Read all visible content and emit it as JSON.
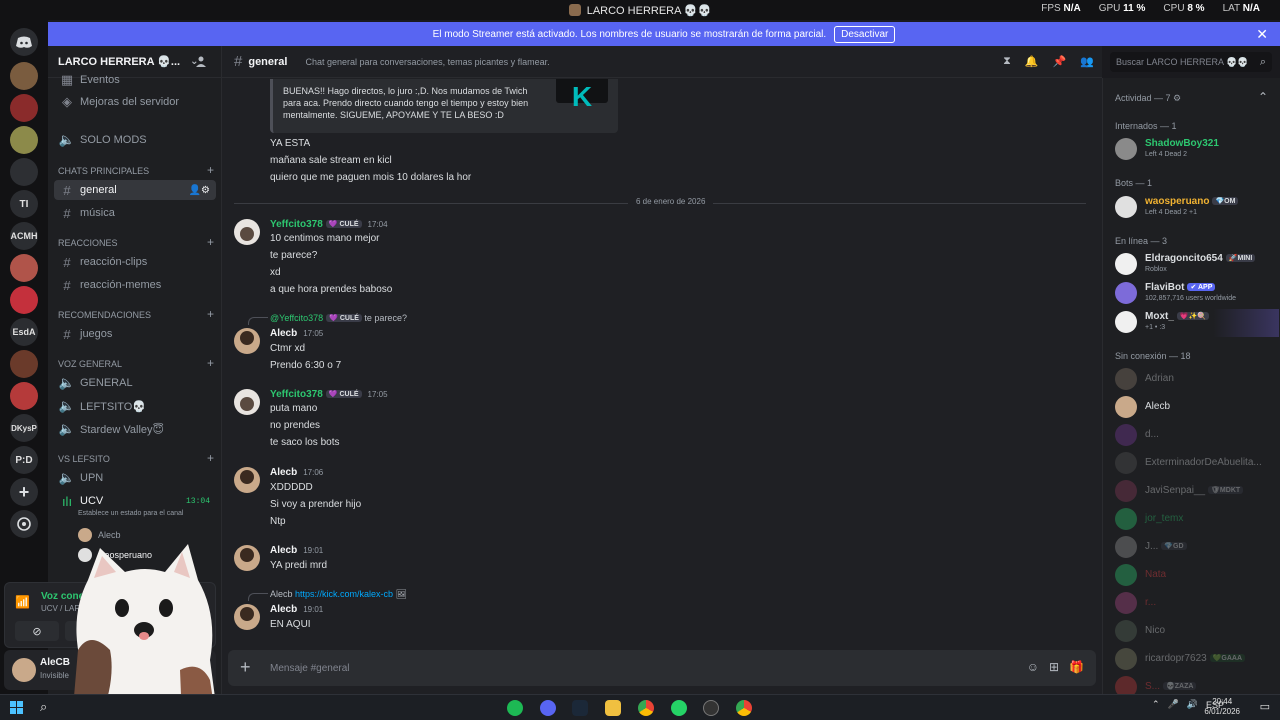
{
  "titlebar": {
    "title": "LARCO HERRERA 💀💀",
    "stats": [
      {
        "k": "FPS",
        "v": "N/A"
      },
      {
        "k": "GPU",
        "v": "11 %"
      },
      {
        "k": "CPU",
        "v": "8 %"
      },
      {
        "k": "LAT",
        "v": "N/A"
      }
    ]
  },
  "banner": {
    "text": "El modo Streamer está activado. Los nombres de usuario se mostrarán de forma parcial.",
    "button": "Desactivar"
  },
  "servers": [
    "TI",
    "ACMH",
    "EsdA",
    "DKysP",
    "P:D"
  ],
  "guild": {
    "name": "LARCO HERRERA 💀...",
    "events": "Eventos",
    "boost": "Mejoras del servidor",
    "solo_mods": "SOLO MODS"
  },
  "categories": {
    "chats": "CHATS PRINCIPALES",
    "reacciones": "REACCIONES",
    "recomendaciones": "RECOMENDACIONES",
    "voz": "VOZ GENERAL",
    "vslefsito": "VS LEFSITO"
  },
  "channels": {
    "general": "general",
    "musica": "música",
    "clips": "reacción-clips",
    "memes": "reacción-memes",
    "juegos": "juegos",
    "v_general": "GENERAL",
    "leftsito": "LEFTSITO💀",
    "stardew": "Stardew Valley😇",
    "upn": "UPN",
    "ucv": "UCV",
    "ucv_time": "13:04",
    "ucv_status": "Establece un estado para el canal",
    "voice_users": [
      "Alecb",
      "waosperuano"
    ]
  },
  "voice_panel": {
    "status": "Voz cone",
    "location": "UCV / LARCO"
  },
  "user_panel": {
    "name": "AleCB",
    "status": "Invisible"
  },
  "header": {
    "channel": "general",
    "topic": "Chat general para conversaciones, temas picantes y flamear.",
    "search_placeholder": "Buscar LARCO HERRERA 💀💀"
  },
  "embed": {
    "text": "BUENAS!! Hago directos, lo juro :,D. Nos mudamos de Twich para aca. Prendo directo cuando tengo el tiempo y estoy bien mentalmente. SIGUEME, APOYAME Y TE LA BESO :D",
    "thumb": "K"
  },
  "pre_lines": [
    "YA ESTA",
    "mañana sale stream en kicl",
    "quiero que me paguen mois 10 dolares la hor"
  ],
  "date_divider": "6 de enero de 2026",
  "messages": [
    {
      "author": "Yeffcito378",
      "tag": "💜 CULÉ",
      "time": "17:04",
      "lines": [
        "10 centimos mano mejor",
        "te parece?",
        "xd",
        "a que hora prendes baboso"
      ]
    },
    {
      "reply_user": "@Yeffcito378",
      "reply_tag": "💜 CULÉ",
      "reply_text": "te parece?",
      "author": "Alecb",
      "time": "17:05",
      "lines": [
        "Ctmr xd",
        "Prendo 6:30 o 7"
      ]
    },
    {
      "author": "Yeffcito378",
      "tag": "💜 CULÉ",
      "time": "17:05",
      "lines": [
        "puta mano",
        "no prendes",
        "te saco los bots"
      ]
    },
    {
      "author": "Alecb",
      "time": "17:06",
      "lines": [
        "XDDDDD",
        "Si voy a prender hijo",
        "Ntp"
      ]
    },
    {
      "author": "Alecb",
      "time": "19:01",
      "lines": [
        "YA predi mrd"
      ]
    },
    {
      "reply_user": "Alecb",
      "reply_link": "https://kick.com/kalex-cb",
      "author": "Alecb",
      "time": "19:01",
      "lines": [
        "EN AQUI"
      ]
    }
  ],
  "composer_placeholder": "Mensaje #general",
  "members": {
    "activity": "Actividad — 7",
    "internados": "Internados — 1",
    "bots": "Bots — 1",
    "online": "En línea — 3",
    "offline": "Sin conexión — 18",
    "list_internados": [
      {
        "name": "ShadowBoy321",
        "sub": "Left 4 Dead 2",
        "color": "#2dc770"
      }
    ],
    "list_bots": [
      {
        "name": "waosperuano",
        "tag": "💎OM",
        "sub": "Left 4 Dead 2 +1",
        "color": "#f0b232"
      }
    ],
    "list_online": [
      {
        "name": "Eldragoncito654",
        "tag": "🚀MINI",
        "sub": "Roblox",
        "color": "#dbdee1"
      },
      {
        "name": "FlaviBot",
        "tag": "✔ APP",
        "sub": "102,857,716 users worldwide",
        "color": "#dbdee1"
      },
      {
        "name": "Moxt_",
        "tag": "💗✨🍭",
        "sub": "+1 • :3",
        "color": "#dbdee1"
      }
    ],
    "list_offline": [
      "Adrian",
      "Alecb",
      "d...",
      "ExterminadorDeAbuelita...",
      "JaviSenpai__",
      "jor_temx",
      "J...",
      "Nata",
      "r...",
      "Nico",
      "ricardopr7623",
      "S..."
    ],
    "offline_tags": {
      "4": "🛡MDKT",
      "6": "💎GD",
      "10": "💚GAAA",
      "11": "💀ZAZA"
    }
  },
  "taskbar": {
    "lang": "ESP",
    "time": "20:44",
    "date": "6/01/2026"
  },
  "colors": {
    "blurple": "#5865f2",
    "green": "#2dc770",
    "link": "#00a8fc"
  }
}
